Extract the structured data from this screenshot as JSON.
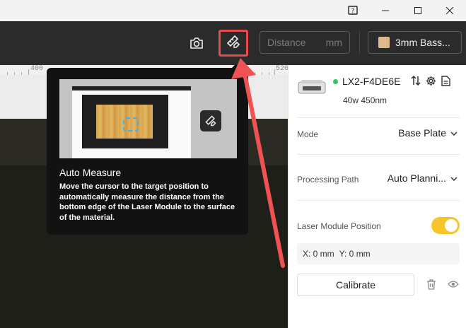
{
  "titlebar": {
    "help_icon": "help-icon",
    "minimize_icon": "minimize-icon",
    "maximize_icon": "maximize-icon",
    "close_icon": "close-icon"
  },
  "toolbar": {
    "camera_icon": "camera-icon",
    "auto_measure_icon": "ruler-pencil-icon",
    "distance_placeholder": "Distance",
    "distance_unit": "mm",
    "material_label": "3mm Bass..."
  },
  "ruler": {
    "labels": [
      "400",
      "520"
    ]
  },
  "tooltip": {
    "title": "Auto Measure",
    "description": "Move the cursor to the target position to automatically measure the distance from the bottom edge of the Laser Module to the surface of the material."
  },
  "panel": {
    "device_name": "LX2-F4DE6E",
    "device_sub": "40w 450nm",
    "status_color": "#35c463",
    "mode_label": "Mode",
    "mode_value": "Base Plate",
    "path_label": "Processing Path",
    "path_value": "Auto Planni...",
    "laser_pos_label": "Laser Module Position",
    "laser_pos_enabled": true,
    "coords": {
      "x": "X: 0 mm",
      "y": "Y: 0 mm"
    },
    "calibrate_label": "Calibrate"
  },
  "colors": {
    "accent": "#f6c42b",
    "highlight": "#e84b4b"
  }
}
